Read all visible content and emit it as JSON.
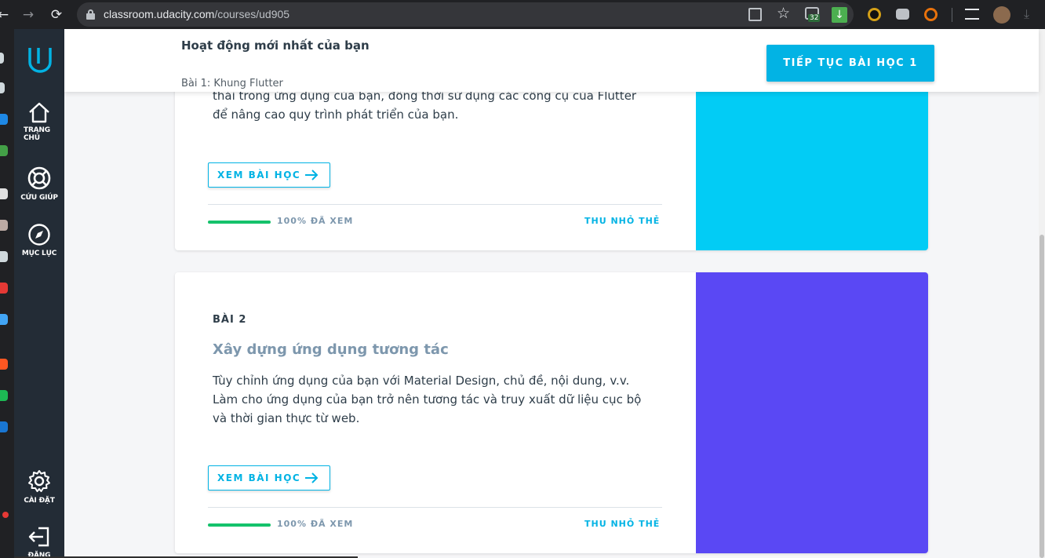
{
  "browser": {
    "url_host": "classroom.udacity.com",
    "url_path": "/courses/ud905",
    "badge_count": "32"
  },
  "sidebar": {
    "items": [
      {
        "label": "TRANG CHỦ",
        "icon": "home-icon"
      },
      {
        "label": "CỨU GIÚP",
        "icon": "lifebuoy-icon"
      },
      {
        "label": "MỤC LỤC",
        "icon": "compass-icon"
      },
      {
        "label": "CÀI ĐẶT",
        "icon": "gear-icon"
      },
      {
        "label": "ĐĂNG",
        "icon": "logout-icon"
      }
    ]
  },
  "header": {
    "title": "Hoạt động mới nhất của bạn",
    "subtitle": "Bài 1: Khung Flutter",
    "cta_label": "TIẾP TỤC BÀI HỌC 1"
  },
  "lessons": [
    {
      "description_partial": "thái trong ứng dụng của bạn, đồng thời sử dụng các công cụ của Flutter để nâng cao quy trình phát triển của bạn.",
      "view_label": "XEM BÀI HỌC",
      "progress_label": "100% ĐÃ XEM",
      "progress": 1.0,
      "collapse_label": "THU NHỎ THẺ",
      "color": "#02ccf5"
    },
    {
      "number": "BÀI 2",
      "title": "Xây dựng ứng dụng tương tác",
      "description": "Tùy chỉnh ứng dụng của bạn với Material Design, chủ đề, nội dung, v.v. Làm cho ứng dụng của bạn trở nên tương tác và truy xuất dữ liệu cục bộ và thời gian thực từ web.",
      "view_label": "XEM BÀI HỌC",
      "progress_label": "100% ĐÃ XEM",
      "progress": 1.0,
      "collapse_label": "THU NHỎ THẺ",
      "color": "#5a48f4"
    }
  ]
}
